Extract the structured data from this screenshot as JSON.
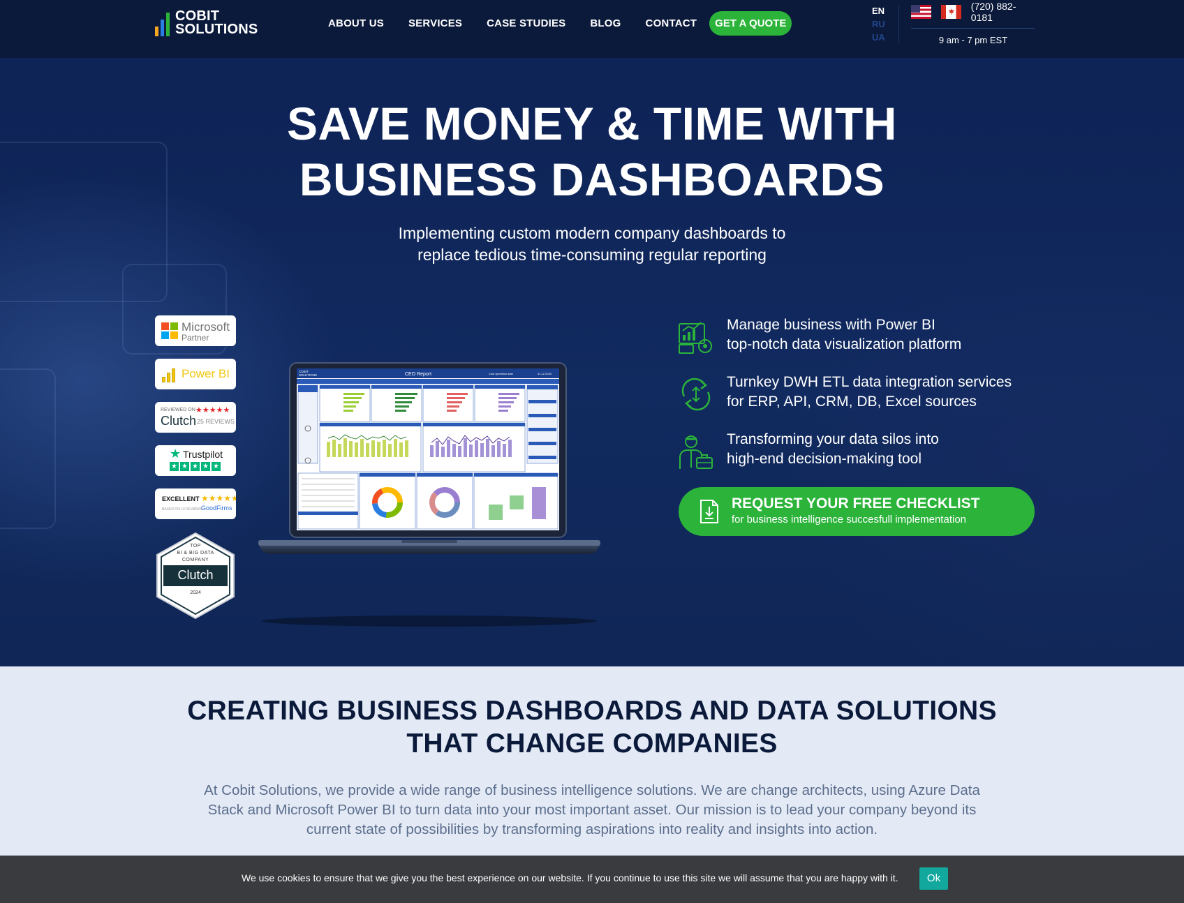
{
  "brand": {
    "name_line1": "COBIT",
    "name_line2": "SOLUTIONS",
    "colors": {
      "navy": "#0b1a3a",
      "accent_green": "#2bb33a",
      "teal_button": "#13a89e"
    }
  },
  "nav": {
    "items": [
      "ABOUT US",
      "SERVICES",
      "CASE STUDIES",
      "BLOG",
      "CONTACT"
    ],
    "cta_label": "GET A QUOTE"
  },
  "languages": {
    "active": "EN",
    "others": [
      "RU",
      "UA"
    ]
  },
  "contact": {
    "flags": [
      "us-flag-icon",
      "canada-flag-icon"
    ],
    "phone": "(720) 882-0181",
    "hours": "9 am - 7 pm EST"
  },
  "hero": {
    "title_line1": "SAVE MONEY & TIME WITH",
    "title_line2": "BUSINESS DASHBOARDS",
    "subtitle_line1": "Implementing custom modern company dashboards to",
    "subtitle_line2": "replace tedious time-consuming regular reporting"
  },
  "badges": {
    "microsoft": {
      "name": "Microsoft",
      "sub": "Partner"
    },
    "powerbi": {
      "name": "Power BI"
    },
    "clutch": {
      "reviewed_on": "REVIEWED ON",
      "name": "Clutch",
      "reviews": "25 REVIEWS",
      "stars": "★★★★★"
    },
    "trustpilot": {
      "name": "Trustpilot",
      "stars": "★★★★★"
    },
    "goodfirms": {
      "label": "EXCELLENT",
      "stars": "★★★★★",
      "based_on": "BASED ON 10 REVIEWS",
      "name": "GoodFirms"
    },
    "clutch_award": {
      "line1": "TOP",
      "line2": "BI & BIG DATA",
      "line3": "COMPANY",
      "name": "Clutch",
      "year": "2024"
    }
  },
  "laptop_screen": {
    "report_title": "CEO Report",
    "logo_line1": "COBIT",
    "logo_line2": "SOLUTIONS",
    "filter": "Cost operation date",
    "date": "31.12.2020"
  },
  "features": [
    {
      "icon": "analytics-chart-icon",
      "line1": "Manage business with Power BI",
      "line2": "top-notch data visualization platform"
    },
    {
      "icon": "data-sync-icon",
      "line1": "Turnkey DWH ETL data integration services",
      "line2": "for ERP, API, CRM, DB, Excel sources"
    },
    {
      "icon": "businessman-briefcase-icon",
      "line1": "Transforming your data silos into",
      "line2": "high-end decision-making tool"
    }
  ],
  "cta": {
    "icon": "document-download-icon",
    "main": "REQUEST YOUR FREE CHECKLIST",
    "sub": "for business intelligence succesfull implementation"
  },
  "about": {
    "title_line1": "CREATING BUSINESS DASHBOARDS AND DATA SOLUTIONS",
    "title_line2": "THAT CHANGE COMPANIES",
    "text_line1": "At Cobit Solutions, we provide a wide range of business intelligence solutions. We are change architects, using Azure Data",
    "text_line2": "Stack and Microsoft Power BI to turn data into your most important asset. Our mission is to lead your company beyond its",
    "text_line3": "current state of possibilities by transforming aspirations into reality and insights into action."
  },
  "cookie": {
    "text": "We use cookies to ensure that we give you the best experience on our website. If you continue to use this site we will assume that you are happy with it.",
    "button": "Ok"
  }
}
